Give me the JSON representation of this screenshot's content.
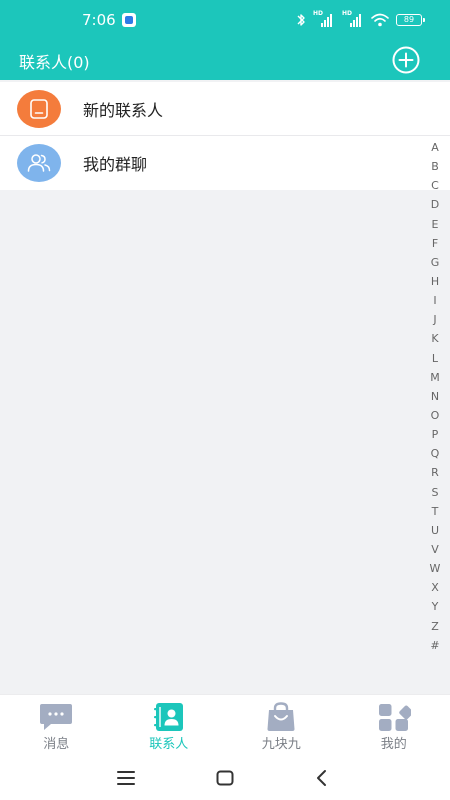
{
  "status_bar": {
    "time": "7:06",
    "signal_1_label": "HD",
    "signal_2_label": "HD",
    "battery_level": "89"
  },
  "header": {
    "title": "联系人(0)",
    "add_icon": "plus-circle-icon"
  },
  "contacts_list": {
    "items": [
      {
        "label": "新的联系人",
        "icon": "new-contact-icon",
        "color": "#f47c3c"
      },
      {
        "label": "我的群聊",
        "icon": "group-chat-icon",
        "color": "#7fb4ec"
      }
    ]
  },
  "alphabet_index": [
    "A",
    "B",
    "C",
    "D",
    "E",
    "F",
    "G",
    "H",
    "I",
    "J",
    "K",
    "L",
    "M",
    "N",
    "O",
    "P",
    "Q",
    "R",
    "S",
    "T",
    "U",
    "V",
    "W",
    "X",
    "Y",
    "Z",
    "#"
  ],
  "tab_bar": {
    "active_color": "#1cc6bb",
    "inactive_color": "#a3adc2",
    "tabs": [
      {
        "label": "消息",
        "icon": "chat-bubble-icon",
        "active": false
      },
      {
        "label": "联系人",
        "icon": "contacts-book-icon",
        "active": true
      },
      {
        "label": "九块九",
        "icon": "shopping-bag-icon",
        "active": false
      },
      {
        "label": "我的",
        "icon": "apps-grid-icon",
        "active": false
      }
    ]
  },
  "nav_bar": {
    "buttons": [
      "menu-icon",
      "home-icon",
      "back-icon"
    ]
  },
  "colors": {
    "brand": "#1cc6bb",
    "background": "#f1f2f4"
  }
}
